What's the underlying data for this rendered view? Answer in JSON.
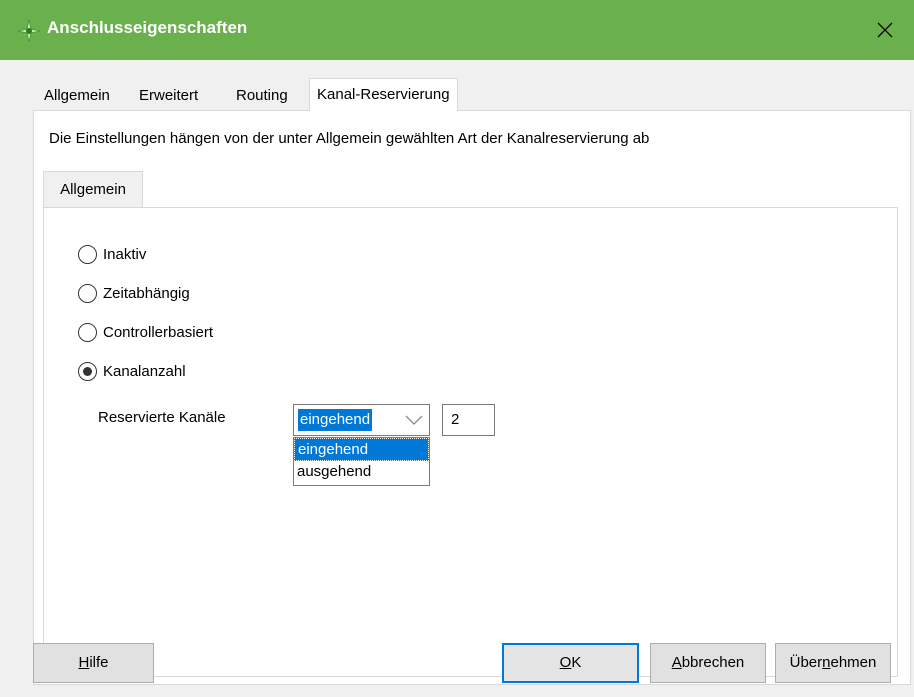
{
  "window": {
    "title": "Anschlusseigenschaften",
    "titlebar_color": "#6ab04c"
  },
  "tabs": [
    {
      "label": "Allgemein"
    },
    {
      "label": "Erweitert"
    },
    {
      "label": "Routing"
    },
    {
      "label": "Kanal-Reservierung",
      "active": true
    }
  ],
  "panel": {
    "info": "Die Einstellungen hängen von der unter Allgemein gewählten Art der Kanalreservierung ab",
    "subtab": "Allgemein",
    "radios": [
      {
        "label": "Inaktiv",
        "checked": false
      },
      {
        "label": "Zeitabhängig",
        "checked": false
      },
      {
        "label": "Controllerbasiert",
        "checked": false
      },
      {
        "label": "Kanalanzahl",
        "checked": true
      }
    ],
    "reserved_label": "Reservierte Kanäle",
    "direction_select": {
      "value": "eingehend",
      "options": [
        "eingehend",
        "ausgehend"
      ]
    },
    "channel_count": "2"
  },
  "buttons": {
    "help": {
      "pre": "",
      "key": "H",
      "post": "ilfe"
    },
    "ok": {
      "pre": "",
      "key": "O",
      "post": "K"
    },
    "cancel": {
      "pre": "",
      "key": "A",
      "post": "bbrechen"
    },
    "apply": {
      "pre": "Über",
      "key": "n",
      "post": "ehmen"
    }
  },
  "icons": {
    "app": "green-diamond-icon",
    "close": "close-icon",
    "dropdown": "chevron-down-icon"
  }
}
